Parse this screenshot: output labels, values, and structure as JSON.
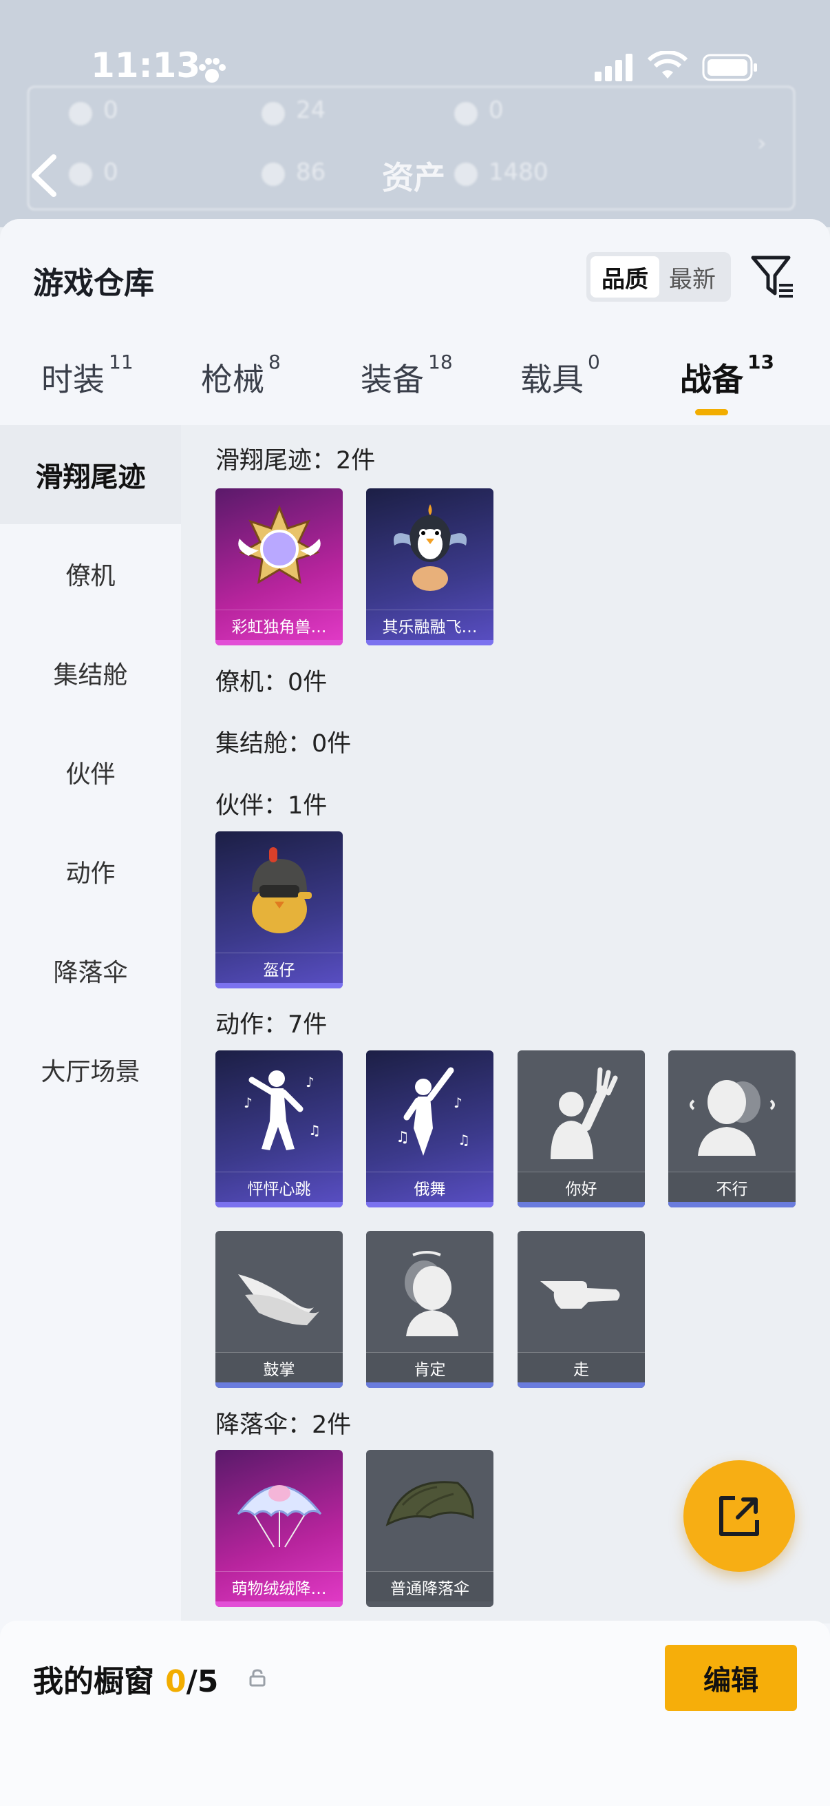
{
  "status_bar": {
    "time": "11:13"
  },
  "header": {
    "title": "资产"
  },
  "warehouse": {
    "title": "游戏仓库",
    "sort": {
      "quality": "品质",
      "latest": "最新"
    }
  },
  "tabs": [
    {
      "label": "时装",
      "count": "11"
    },
    {
      "label": "枪械",
      "count": "8"
    },
    {
      "label": "装备",
      "count": "18"
    },
    {
      "label": "载具",
      "count": "0"
    },
    {
      "label": "战备",
      "count": "13",
      "active": true
    }
  ],
  "sidebar": [
    {
      "label": "滑翔尾迹",
      "active": true
    },
    {
      "label": "僚机"
    },
    {
      "label": "集结舱"
    },
    {
      "label": "伙伴"
    },
    {
      "label": "动作"
    },
    {
      "label": "降落伞"
    },
    {
      "label": "大厅场景"
    }
  ],
  "sections": {
    "trail": {
      "title": "滑翔尾迹：2件",
      "items": [
        "彩虹独角兽…",
        "其乐融融飞…"
      ]
    },
    "wingman": {
      "title": "僚机：0件"
    },
    "capsule": {
      "title": "集结舱：0件"
    },
    "partner": {
      "title": "伙伴：1件",
      "items": [
        "盔仔"
      ]
    },
    "emote": {
      "title": "动作：7件",
      "items": [
        "怦怦心跳",
        "俄舞",
        "你好",
        "不行",
        "鼓掌",
        "肯定",
        "走"
      ]
    },
    "parachute": {
      "title": "降落伞：2件",
      "items": [
        "萌物绒绒降…",
        "普通降落伞"
      ]
    }
  },
  "showcase": {
    "label": "我的橱窗",
    "current": "0",
    "total": "/5",
    "edit_label": "编辑"
  },
  "colors": {
    "accent": "#f2ad00",
    "pink_card": "#c22aa8",
    "purple_card": "#3c3a8c",
    "gray_card": "#555a63"
  }
}
